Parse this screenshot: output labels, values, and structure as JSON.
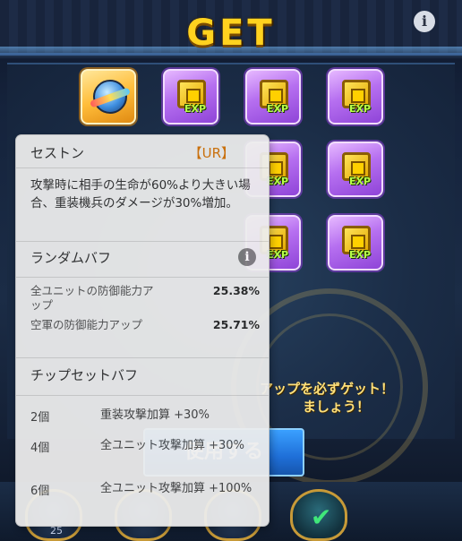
{
  "header": {
    "title": "GET",
    "info_icon": "i"
  },
  "rewards": [
    {
      "kind": "gold",
      "icon": "core-orb-icon"
    },
    {
      "kind": "purple",
      "icon": "exp-chip-icon",
      "label": "EXP"
    },
    {
      "kind": "purple",
      "icon": "exp-chip-icon",
      "label": "EXP"
    },
    {
      "kind": "purple",
      "icon": "exp-chip-icon",
      "label": "EXP"
    },
    {
      "kind": "purple",
      "icon": "exp-chip-icon",
      "label": "EXP"
    },
    {
      "kind": "purple",
      "icon": "exp-chip-icon",
      "label": "EXP"
    },
    {
      "kind": "purple",
      "icon": "exp-chip-icon",
      "label": "EXP"
    },
    {
      "kind": "purple",
      "icon": "exp-chip-icon",
      "label": "EXP"
    }
  ],
  "banner": {
    "line1": "アップを必ずゲット！",
    "line2": "ましょう！"
  },
  "use_button": {
    "label": "使用する"
  },
  "bottom": {
    "level": "25"
  },
  "tooltip": {
    "name": "セストン",
    "rarity": "【UR】",
    "description": "攻撃時に相手の生命が60%より大きい場合、重装機兵のダメージが30%増加。",
    "random_buff_title": "ランダムバフ",
    "info_icon": "i",
    "random_buffs": [
      {
        "name": "全ユニットの防御能力アップ",
        "value": "25.38%"
      },
      {
        "name": "空軍の防御能力アップ",
        "value": "25.71%"
      }
    ],
    "chip_set_title": "チップセットバフ",
    "set_buffs": [
      {
        "count": "2個",
        "text": "重装攻撃加算 +30%"
      },
      {
        "count": "4個",
        "text": "全ユニット攻撃加算 +30%"
      },
      {
        "count": "6個",
        "text": "全ユニット攻撃加算 +100%"
      }
    ]
  },
  "colors": {
    "title_gold": "#ffd21f",
    "rarity_orange": "#d4740a",
    "tile_purple": "#b66ff0",
    "tile_gold": "#ffbd3a"
  }
}
